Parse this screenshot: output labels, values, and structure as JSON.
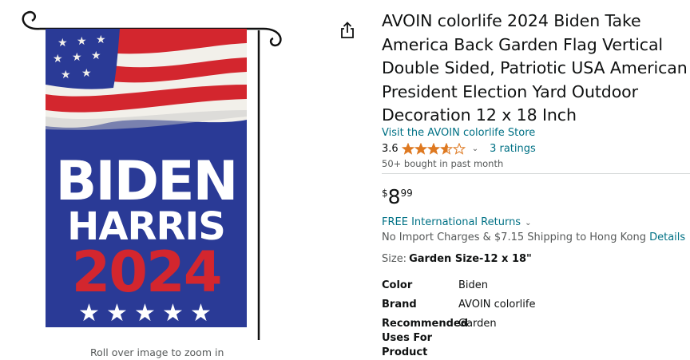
{
  "image": {
    "zoom_hint": "Roll over image to zoom in",
    "flag_text": {
      "line1": "BIDEN",
      "line2": "HARRIS",
      "line3": "2024"
    }
  },
  "product": {
    "title": "AVOIN colorlife 2024 Biden Take America Back Garden Flag Vertical Double Sided, Patriotic USA American President Election Yard Outdoor Decoration 12 x 18 Inch",
    "store_link": "Visit the AVOIN colorlife Store",
    "rating": "3.6",
    "rating_value": 3.6,
    "ratings_count": "3 ratings",
    "bought_badge": "50+ bought in past month"
  },
  "price": {
    "currency": "$",
    "whole": "8",
    "fraction": "99"
  },
  "returns": {
    "label": "FREE International Returns"
  },
  "shipping": {
    "text": "No Import Charges & $7.15 Shipping to Hong Kong",
    "details_link": "Details"
  },
  "size": {
    "label": "Size:",
    "value": "Garden Size-12 x 18\""
  },
  "specs": [
    {
      "label": "Color",
      "value": "Biden"
    },
    {
      "label": "Brand",
      "value": "AVOIN colorlife"
    },
    {
      "label": "Recommended Uses For Product",
      "value": "Garden"
    }
  ],
  "icons": {
    "share": "share-icon",
    "star": "star-icon",
    "chevron": "chevron-down-icon"
  },
  "colors": {
    "link": "#007185",
    "star": "#DE7921",
    "text": "#0F1111",
    "secondary": "#565959",
    "flag_blue": "#2a3a96",
    "flag_red": "#d3262e"
  }
}
